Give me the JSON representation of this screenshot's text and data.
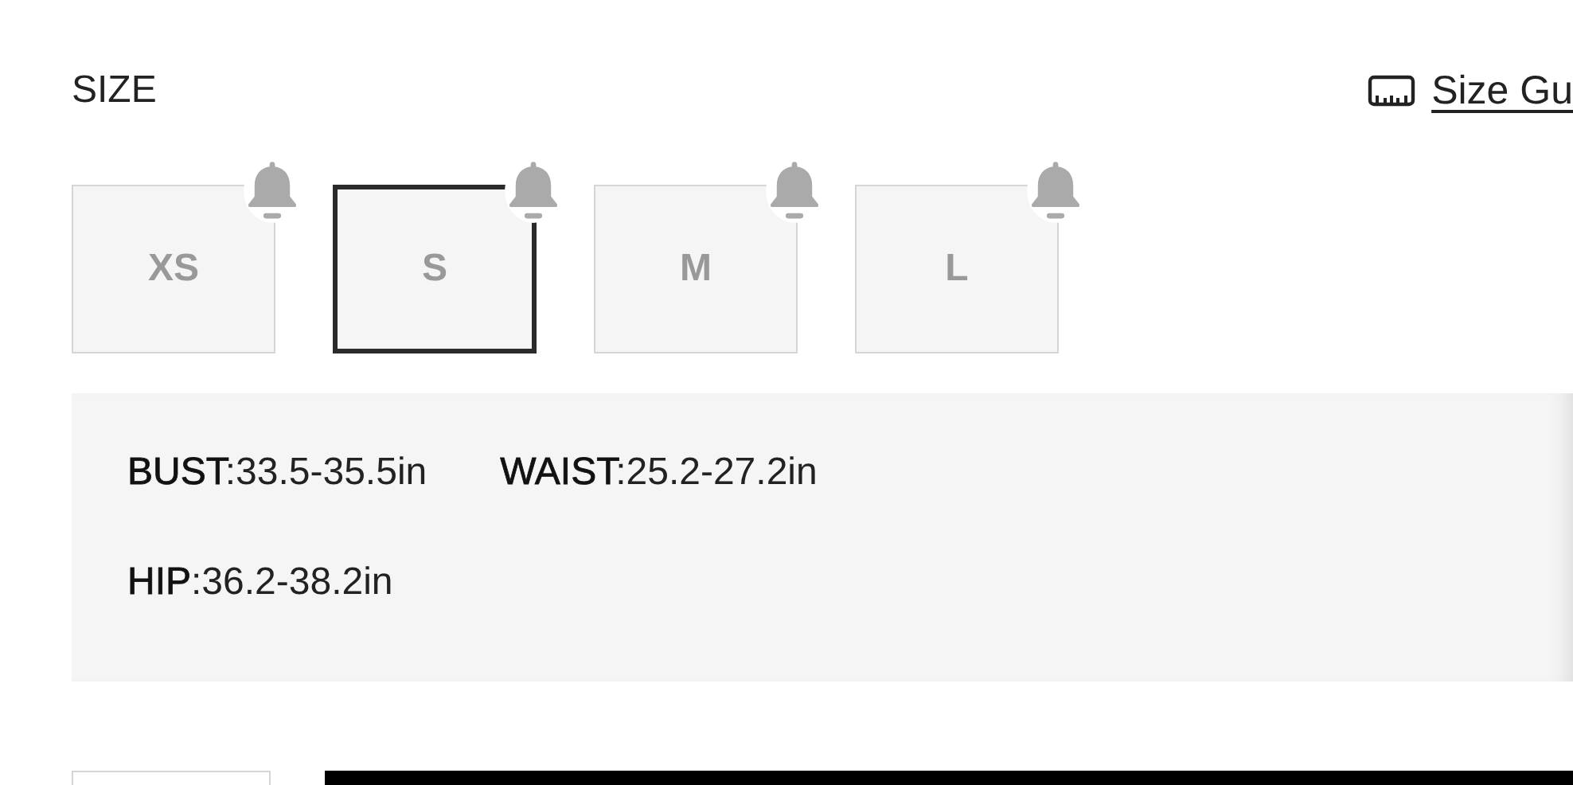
{
  "title": "SIZE",
  "size_guide": {
    "label": "Size Gu"
  },
  "sizes": [
    {
      "label": "XS",
      "selected": false,
      "notify": true
    },
    {
      "label": "S",
      "selected": true,
      "notify": true
    },
    {
      "label": "M",
      "selected": false,
      "notify": true
    },
    {
      "label": "L",
      "selected": false,
      "notify": true
    }
  ],
  "measurements": [
    [
      "**BUST**:33.5-35.5in",
      "**WAIST**:25.2-27.2in"
    ],
    [
      "**HIP**:36.2-38.2in"
    ]
  ]
}
